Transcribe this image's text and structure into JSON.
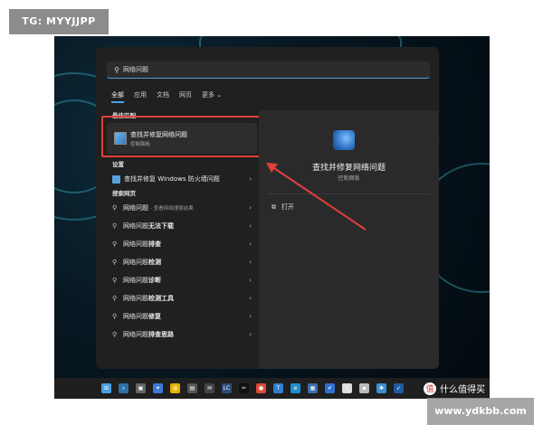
{
  "watermark": {
    "tg": "TG: MYYJJPP",
    "site": "www.ydkbb.com",
    "brand": "什么值得买"
  },
  "search": {
    "query": "网络问题",
    "icon": "search-icon"
  },
  "filters": {
    "tabs": [
      "全部",
      "应用",
      "文档",
      "网页",
      "更多"
    ],
    "more_chevron": "⌄"
  },
  "best_match": {
    "section": "最佳匹配",
    "title": "查找并修复网络问题",
    "subtitle": "控制面板"
  },
  "settings": {
    "section": "设置",
    "item": "查找并修复 Windows 防火墙问题"
  },
  "web": {
    "section": "搜索网页",
    "items": [
      {
        "prefix": "网络问题",
        "suffix": "",
        "muted": " - 查看网络搜索结果"
      },
      {
        "prefix": "网络问题",
        "suffix": "无法下载",
        "muted": ""
      },
      {
        "prefix": "网络问题",
        "suffix": "排查",
        "muted": ""
      },
      {
        "prefix": "网络问题",
        "suffix": "检测",
        "muted": ""
      },
      {
        "prefix": "网络问题",
        "suffix": "诊断",
        "muted": ""
      },
      {
        "prefix": "网络问题",
        "suffix": "检测工具",
        "muted": ""
      },
      {
        "prefix": "网络问题",
        "suffix": "修复",
        "muted": ""
      },
      {
        "prefix": "网络问题",
        "suffix": "排查思路",
        "muted": ""
      }
    ]
  },
  "detail": {
    "title": "查找并修复网络问题",
    "subtitle": "控制面板",
    "open": "打开"
  },
  "taskbar": {
    "icons": [
      {
        "name": "windows-start-icon",
        "glyph": "⊞",
        "color": "#4aa0e0"
      },
      {
        "name": "search-icon",
        "glyph": "⌕",
        "color": "#2f6fa8"
      },
      {
        "name": "task-view-icon",
        "glyph": "▣",
        "color": "#666"
      },
      {
        "name": "feishu-icon",
        "glyph": "✦",
        "color": "#3a7bd5"
      },
      {
        "name": "notes-icon",
        "glyph": "◍",
        "color": "#e6b200"
      },
      {
        "name": "remote-icon",
        "glyph": "▤",
        "color": "#555"
      },
      {
        "name": "chat-icon",
        "glyph": "✉",
        "color": "#444"
      },
      {
        "name": "lc-icon",
        "glyph": "LC",
        "color": "#2d4c7a"
      },
      {
        "name": "capcut-icon",
        "glyph": "✂",
        "color": "#111"
      },
      {
        "name": "chrome-icon",
        "glyph": "●",
        "color": "#d94b3a"
      },
      {
        "name": "translate-icon",
        "glyph": "T",
        "color": "#2f7fd0"
      },
      {
        "name": "edge-icon",
        "glyph": "e",
        "color": "#1f8fcf"
      },
      {
        "name": "calendar-icon",
        "glyph": "▦",
        "color": "#3a6fb0"
      },
      {
        "name": "check-icon",
        "glyph": "✔",
        "color": "#2f6fd0"
      },
      {
        "name": "file-icon",
        "glyph": "▯",
        "color": "#ddd"
      },
      {
        "name": "pin-icon",
        "glyph": "▪",
        "color": "#bbb"
      },
      {
        "name": "star-icon",
        "glyph": "✱",
        "color": "#3a8fd0"
      },
      {
        "name": "feather-icon",
        "glyph": "➶",
        "color": "#1f5aa0"
      }
    ]
  },
  "colors": {
    "highlight": "#e0403a",
    "accent": "#4aa0e0",
    "panel": "#202020"
  }
}
